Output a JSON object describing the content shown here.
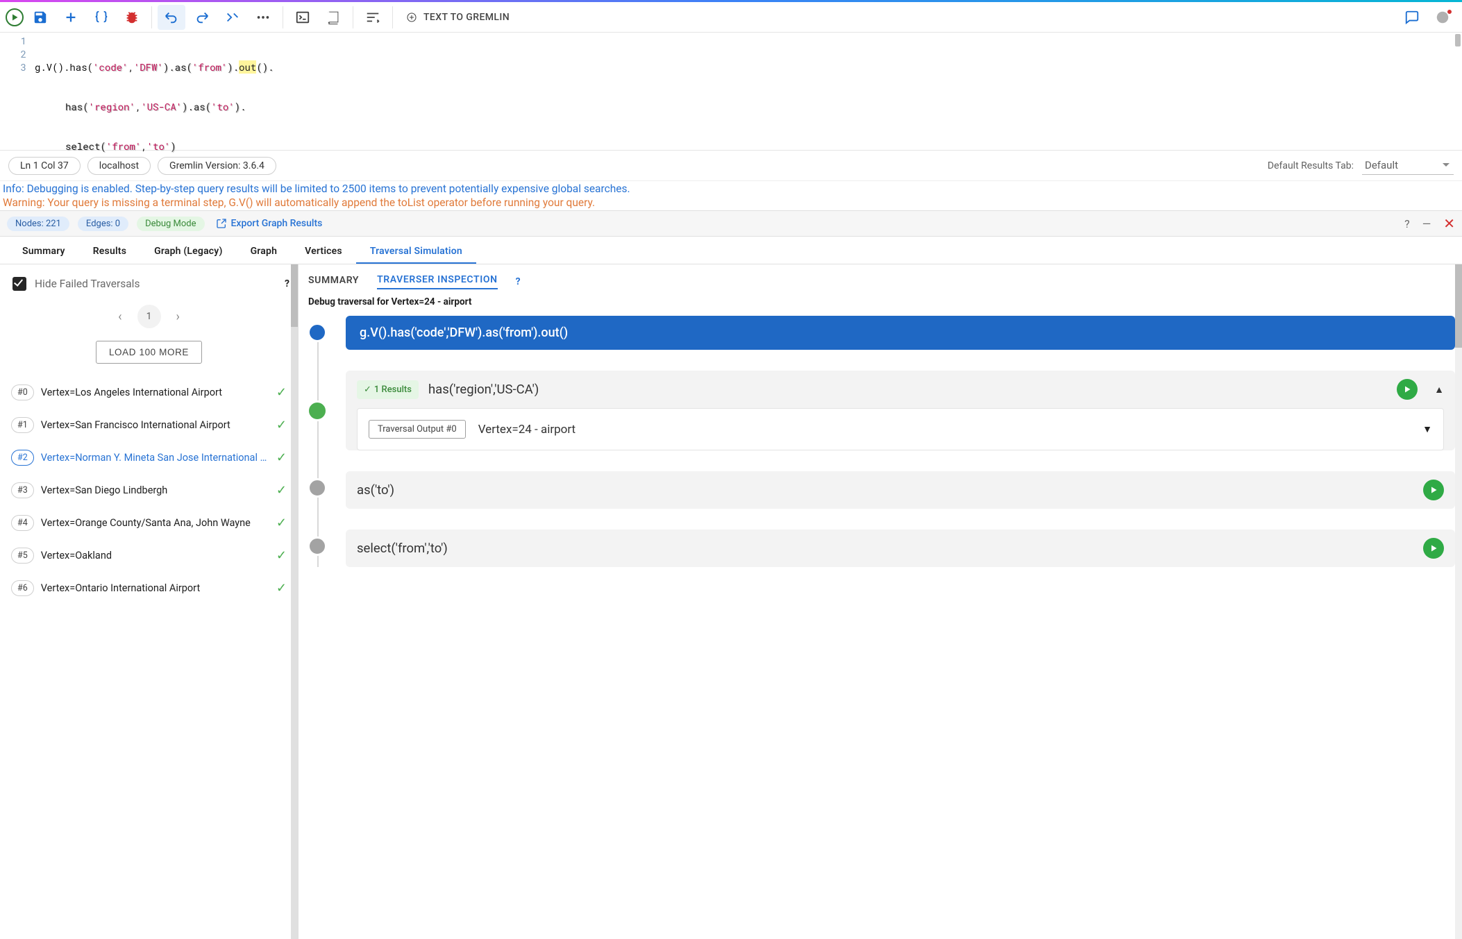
{
  "toolbar": {
    "text_to_gremlin": "TEXT TO GREMLIN"
  },
  "editor": {
    "line_numbers": [
      "1",
      "2",
      "3"
    ],
    "line1": {
      "p": "g.V().has(",
      "s1": "'code'",
      "c": ",",
      "s2": "'DFW'",
      "p2": ").as(",
      "s3": "'from'",
      "p3": ").",
      "out": "out",
      "p4": "()."
    },
    "line2": {
      "p": "has(",
      "s1": "'region'",
      "c": ",",
      "s2": "'US-CA'",
      "p2": ").as(",
      "s3": "'to'",
      "p3": ")."
    },
    "line3": {
      "p": "select(",
      "s1": "'from'",
      "c": ",",
      "s2": "'to'",
      "p2": ")"
    },
    "cursor": "Ln 1 Col 37",
    "host": "localhost",
    "version": "Gremlin Version: 3.6.4"
  },
  "defaults": {
    "label": "Default Results Tab:",
    "value": "Default"
  },
  "messages": {
    "info": "Info: Debugging is enabled. Step-by-step query results will be limited to 2500 items to prevent potentially expensive global searches.",
    "warn": "Warning: Your query is missing a terminal step, G.V() will automatically append the toList operator before running your query."
  },
  "sec": {
    "nodes": "Nodes: 221",
    "edges": "Edges: 0",
    "debug": "Debug Mode",
    "export": "Export Graph Results",
    "help": "?",
    "min": "—",
    "close": "✕"
  },
  "tabs": {
    "summary": "Summary",
    "results": "Results",
    "graph_legacy": "Graph (Legacy)",
    "graph": "Graph",
    "vertices": "Vertices",
    "traversal": "Traversal Simulation"
  },
  "left": {
    "hide_label": "Hide Failed Traversals",
    "help": "?",
    "page": "1",
    "load_more": "LOAD 100 MORE",
    "items": [
      {
        "n": "#0",
        "label": "Vertex=Los Angeles International Airport"
      },
      {
        "n": "#1",
        "label": "Vertex=San Francisco International Airport"
      },
      {
        "n": "#2",
        "label": "Vertex=Norman Y. Mineta San Jose International Airp"
      },
      {
        "n": "#3",
        "label": "Vertex=San Diego Lindbergh"
      },
      {
        "n": "#4",
        "label": "Vertex=Orange County/Santa Ana, John Wayne"
      },
      {
        "n": "#5",
        "label": "Vertex=Oakland"
      },
      {
        "n": "#6",
        "label": "Vertex=Ontario International Airport"
      }
    ]
  },
  "right": {
    "subtabs": {
      "summary": "SUMMARY",
      "inspect": "TRAVERSER INSPECTION",
      "help": "?"
    },
    "debug_for": "Debug traversal for Vertex=24 - airport",
    "hero": "g.V().has('code','DFW').as('from').out()",
    "step1": {
      "results": "1 Results",
      "code": "has('region','US-CA')"
    },
    "step1_output": {
      "badge": "Traversal Output #0",
      "text": "Vertex=24 - airport"
    },
    "step2": {
      "code": "as('to')"
    },
    "step3": {
      "code": "select('from','to')"
    }
  }
}
